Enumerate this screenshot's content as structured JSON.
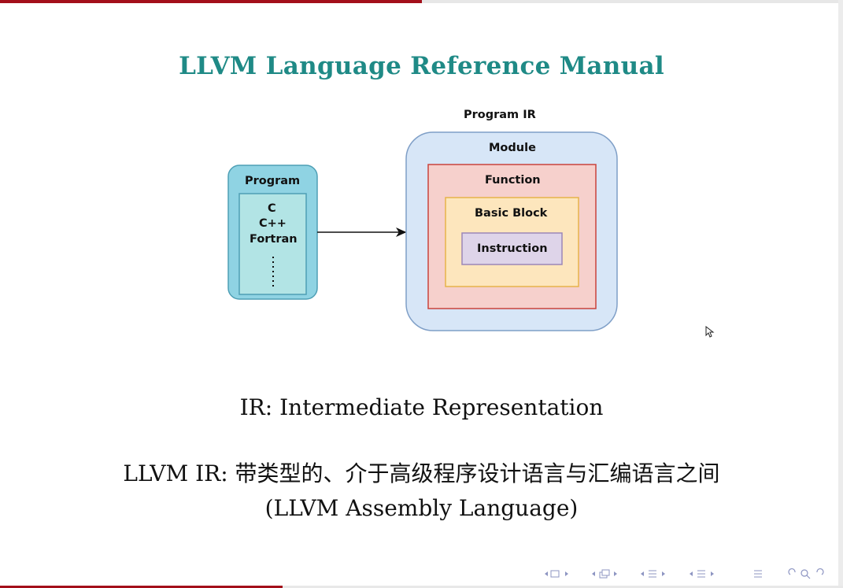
{
  "slide": {
    "title": "LLVM Language Reference Manual",
    "ir_line": "IR: Intermediate Representation",
    "llvm_ir_line": "LLVM IR: 带类型的、介于高级程序设计语言与汇编语言之间",
    "assembly_line": "(LLVM Assembly Language)"
  },
  "diagram": {
    "program_ir_label": "Program IR",
    "module_label": "Module",
    "function_label": "Function",
    "basic_block_label": "Basic Block",
    "instruction_label": "Instruction",
    "program_label": "Program",
    "languages": [
      "C",
      "C++",
      "Fortran"
    ],
    "colors": {
      "program_outer": "#8fd3e3",
      "program_inner": "#b2e4e5",
      "module": "#d7e6f7",
      "function": "#f6d0cc",
      "function_border": "#c9433d",
      "basic_block": "#fde6bd",
      "basic_block_border": "#e6b34a",
      "instruction": "#ded4e9",
      "instruction_border": "#9b86b8"
    }
  },
  "progress": {
    "top_fraction": 0.5,
    "bottom_fraction": 0.335
  },
  "theme": {
    "title_color": "#1f8a86",
    "accent_red": "#a30f1a"
  },
  "icons": {
    "cursor": "mouse-pointer-icon",
    "nav": [
      "nav-frame-prev-icon",
      "nav-subsection-prev-icon",
      "nav-section-prev-icon",
      "nav-toc-icon",
      "nav-search-icon"
    ]
  }
}
